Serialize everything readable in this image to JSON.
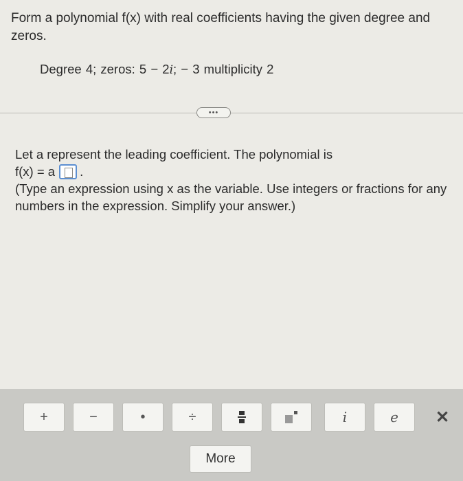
{
  "question": {
    "prompt": "Form a polynomial f(x) with real coefficients having the given degree and zeros.",
    "given_prefix": "Degree 4;   zeros: 5 − 2",
    "given_imag": "i",
    "given_suffix": ";  − 3 multiplicity 2"
  },
  "divider": {
    "more_label": "•••"
  },
  "answer": {
    "line1": "Let a represent the leading coefficient. The polynomial is",
    "fx_prefix": "f(x) = a",
    "fx_suffix": ".",
    "instructions": "(Type an expression using x as the variable. Use integers or fractions for any numbers in the expression. Simplify your answer.)"
  },
  "toolbar": {
    "plus": "+",
    "minus": "−",
    "times": "•",
    "divide": "÷",
    "imag": "i",
    "e": "e",
    "close": "✕",
    "more": "More"
  }
}
